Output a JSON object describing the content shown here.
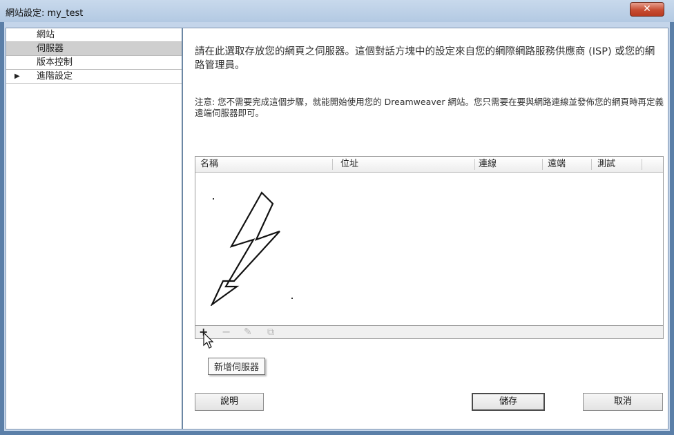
{
  "window": {
    "title": "網站設定: my_test",
    "close_label": "✕"
  },
  "sidebar": {
    "items": [
      {
        "label": "網站"
      },
      {
        "label": "伺服器"
      },
      {
        "label": "版本控制"
      },
      {
        "label": "進階設定"
      }
    ],
    "expand_glyph": "▶"
  },
  "main": {
    "intro": "請在此選取存放您的網頁之伺服器。這個對話方塊中的設定來自您的網際網路服務供應商 (ISP) 或您的網路管理員。",
    "note": "注意: 您不需要完成這個步驟，就能開始使用您的 Dreamweaver 網站。您只需要在要與網路連線並發佈您的網頁時再定義遠端伺服器即可。"
  },
  "table": {
    "columns": [
      "名稱",
      "位址",
      "連線",
      "遠端",
      "測試"
    ],
    "rows": []
  },
  "toolbar": {
    "add_glyph": "+",
    "remove_glyph": "−",
    "edit_glyph": "✎",
    "duplicate_glyph": "⧉",
    "add_tooltip": "新增伺服器"
  },
  "buttons": {
    "help": "說明",
    "save": "儲存",
    "cancel": "取消"
  },
  "icons": {
    "annotation": "lightning-bolt-arrow-icon",
    "cursor": "mouse-pointer-icon"
  }
}
